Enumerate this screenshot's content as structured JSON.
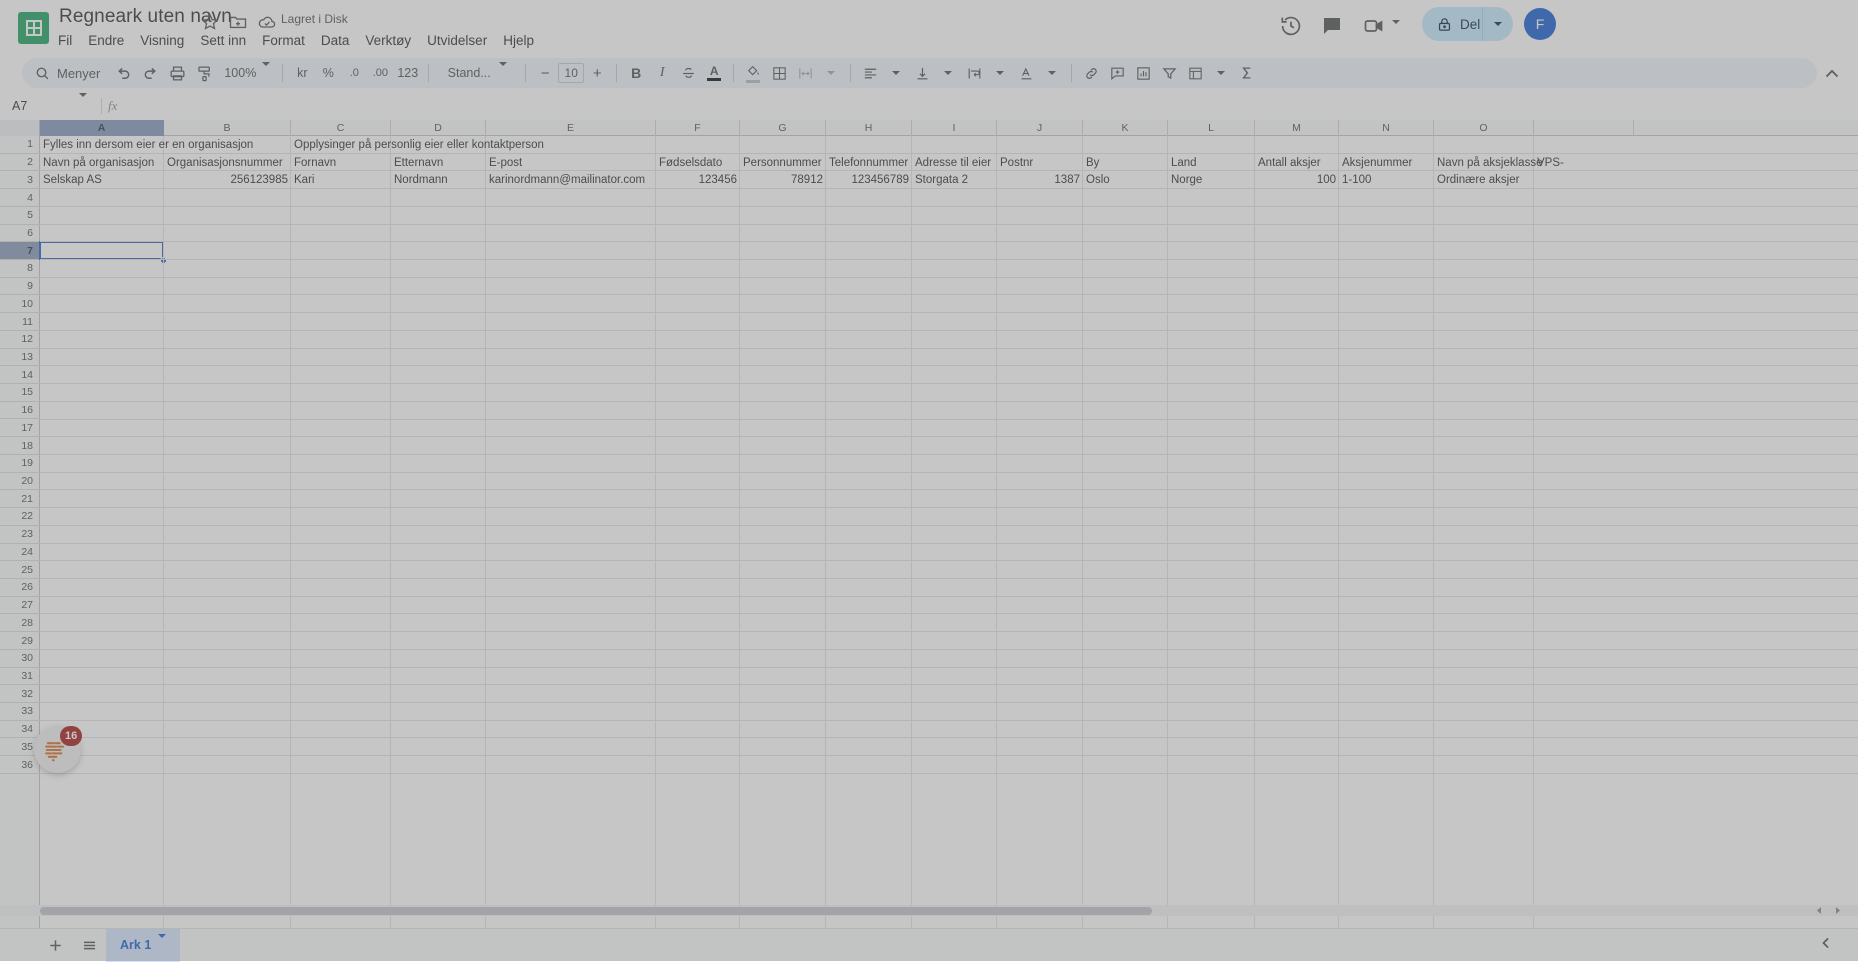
{
  "app": {
    "logo_icon": "sheets-logo-icon",
    "doc_title": "Regneark uten navn",
    "star_icon": "star-icon",
    "move_folder_icon": "folder-move-icon",
    "cloud_icon": "cloud-saved-icon",
    "save_status": "Lagret i Disk"
  },
  "menubar": {
    "items": [
      {
        "label": "Fil"
      },
      {
        "label": "Endre"
      },
      {
        "label": "Visning"
      },
      {
        "label": "Sett inn"
      },
      {
        "label": "Format"
      },
      {
        "label": "Data"
      },
      {
        "label": "Verktøy"
      },
      {
        "label": "Utvidelser"
      },
      {
        "label": "Hjelp"
      }
    ]
  },
  "header_right": {
    "history_icon": "history-clock-icon",
    "comment_icon": "comment-icon",
    "meet_icon": "video-camera-icon",
    "share_label": "Del",
    "share_lock_icon": "lock-icon",
    "avatar_initial": "F"
  },
  "toolbar": {
    "search_label": "Menyer",
    "search_icon": "search-icon",
    "undo_icon": "undo-icon",
    "redo_icon": "redo-icon",
    "print_icon": "print-icon",
    "paint_format_icon": "paint-format-icon",
    "zoom_value": "100%",
    "currency_label": "kr",
    "percent_label": "%",
    "decimal_decrease_label": ".0",
    "decimal_increase_label": ".00",
    "number_format_label": "123",
    "font_name": "Stand...",
    "font_size_decrease": "−",
    "font_size_value": "10",
    "font_size_increase": "+",
    "bold_label": "B",
    "italic_label": "I",
    "strikethrough_icon": "strikethrough-icon",
    "text_color_label": "A",
    "fill_color_icon": "fill-color-icon",
    "borders_icon": "borders-icon",
    "merge_cells_icon": "merge-cells-icon",
    "horizontal_align_icon": "horizontal-align-icon",
    "vertical_align_icon": "vertical-align-icon",
    "text_wrap_icon": "text-wrapping-icon",
    "text_rotation_icon": "text-rotation-icon",
    "insert_link_icon": "insert-link-icon",
    "insert_comment_icon": "insert-comment-icon",
    "insert_chart_icon": "insert-chart-icon",
    "filter_icon": "filter-icon",
    "functions_icon": "pivot-table-icon",
    "sum_icon": "sum-sigma-icon",
    "collapse_icon": "chevron-up-icon"
  },
  "formula_bar": {
    "name_box_value": "A7",
    "name_box_caret_icon": "chevron-down-icon",
    "fx_label": "fx",
    "formula_value": ""
  },
  "grid": {
    "columns": [
      "A",
      "B",
      "C",
      "D",
      "E",
      "F",
      "G",
      "H",
      "I",
      "J",
      "K",
      "L",
      "M",
      "N",
      "O"
    ],
    "selected_column": "A",
    "selected_cell": "A7",
    "selected_row": 7,
    "row_count": 36,
    "rows": [
      {
        "num": 1,
        "cells": {
          "A": "Fylles inn dersom eier er en organisasjon",
          "C": "Opplysinger på personlig eier eller kontaktperson"
        }
      },
      {
        "num": 2,
        "cells": {
          "A": "Navn på organisasjon",
          "B": "Organisasjonsnummer",
          "C": "Fornavn",
          "D": "Etternavn",
          "E": "E-post",
          "F": "Fødselsdato",
          "G": "Personnummer",
          "H": "Telefonnummer",
          "I": "Adresse til eier",
          "J": "Postnr",
          "K": "By",
          "L": "Land",
          "M": "Antall aksjer",
          "N": "Aksjenummer",
          "O": "Navn på aksjeklasse",
          "P": "VPS-"
        }
      },
      {
        "num": 3,
        "cells": {
          "A": "Selskap AS",
          "B": "256123985",
          "C": "Kari",
          "D": "Nordmann",
          "E": "karinordmann@mailinator.com",
          "F": "123456",
          "G": "78912",
          "H": "123456789",
          "I": "Storgata 2",
          "J": "1387",
          "K": "Oslo",
          "L": "Norge",
          "M": "100",
          "N": "1-100",
          "O": "Ordinære aksjer"
        }
      }
    ],
    "numeric_columns": [
      "B",
      "F",
      "G",
      "H",
      "J",
      "M"
    ]
  },
  "bottom_bar": {
    "add_sheet_icon": "add-sheet-icon",
    "all_sheets_icon": "all-sheets-icon",
    "sheet_tab_label": "Ark 1",
    "sheet_tab_caret_icon": "chevron-down-icon",
    "collapse_icon": "chevron-left-icon"
  },
  "assistant": {
    "icon": "assistant-brain-icon",
    "badge_count": "16"
  }
}
